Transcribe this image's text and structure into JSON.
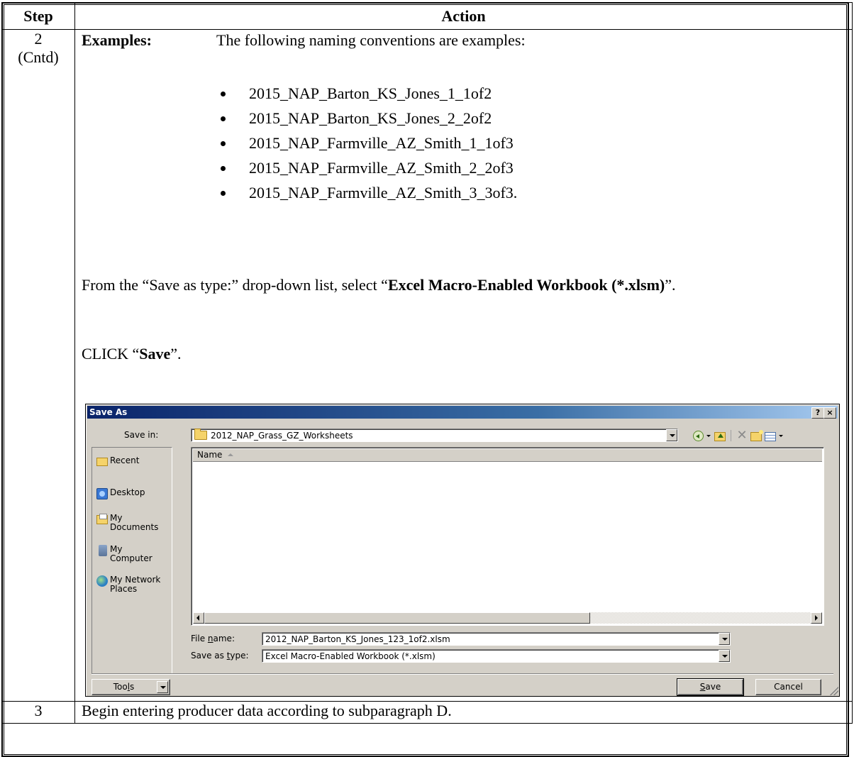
{
  "table": {
    "header_step": "Step",
    "header_action": "Action",
    "row2_step": "2",
    "row2_step_sub": "(Cntd)",
    "examples_label": "Examples:",
    "examples_text": "The following naming conventions are examples:",
    "examples": [
      "2015_NAP_Barton_KS_Jones_1_1of2",
      "2015_NAP_Barton_KS_Jones_2_2of2",
      "2015_NAP_Farmville_AZ_Smith_1_1of3",
      "2015_NAP_Farmville_AZ_Smith_2_2of3",
      "2015_NAP_Farmville_AZ_Smith_3_3of3."
    ],
    "para1_pre": "From the “Save as type:” drop-down list, select “",
    "para1_bold": "Excel Macro-Enabled Workbook (*.xlsm)",
    "para1_post": "”.",
    "para2_pre": "CLICK “",
    "para2_bold": "Save",
    "para2_post": "”.",
    "row3_step": "3",
    "row3_action": "Begin entering producer data according to subparagraph D."
  },
  "dialog": {
    "title": "Save As",
    "help_btn": "?",
    "close_btn": "×",
    "save_in_label": "Save in:",
    "save_in_value": "2012_NAP_Grass_GZ_Worksheets",
    "places": [
      {
        "line1": "Recent",
        "line2": ""
      },
      {
        "line1": "Desktop",
        "line2": ""
      },
      {
        "line1": "My",
        "line2": "Documents"
      },
      {
        "line1": "My",
        "line2": "Computer"
      },
      {
        "line1": "My Network",
        "line2": "Places"
      }
    ],
    "column_name": "Name",
    "file_name_label_pre": "File ",
    "file_name_label_u": "n",
    "file_name_label_post": "ame:",
    "file_name_value": "2012_NAP_Barton_KS_Jones_123_1of2.xlsm",
    "save_type_label_pre": "Save as ",
    "save_type_label_u": "t",
    "save_type_label_post": "ype:",
    "save_type_value": "Excel Macro-Enabled Workbook (*.xlsm)",
    "tools_pre": "Too",
    "tools_u": "l",
    "tools_post": "s",
    "save_u": "S",
    "save_post": "ave",
    "cancel_label": "Cancel",
    "icons": [
      "back-icon",
      "up-folder-icon",
      "delete-icon",
      "new-folder-icon",
      "views-icon"
    ]
  }
}
